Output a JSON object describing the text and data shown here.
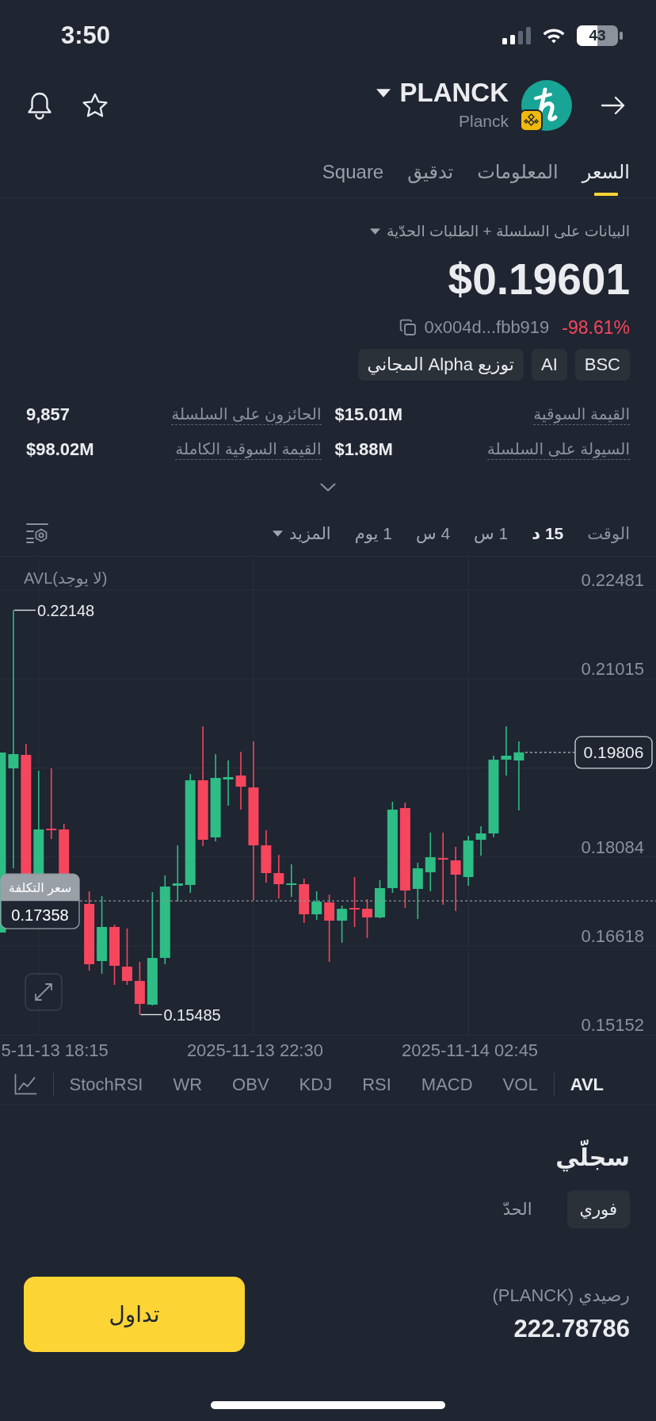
{
  "status_bar": {
    "time": "3:50",
    "battery": "43"
  },
  "header": {
    "symbol": "PLANCK",
    "name": "Planck"
  },
  "tabs": [
    {
      "label": "السعر",
      "selected": true
    },
    {
      "label": "المعلومات",
      "selected": false
    },
    {
      "label": "تدقيق",
      "selected": false
    },
    {
      "label": "Square",
      "selected": false
    }
  ],
  "price_section": {
    "source": "البيانات على السلسلة + الطلبات الحدّية",
    "price": "$0.19601",
    "contract": "0x004d...fbb919",
    "change": "-98.61%",
    "change_up": false,
    "tags": [
      "BSC",
      "AI",
      "توزيع Alpha المجاني"
    ]
  },
  "stats": [
    {
      "label": "القيمة السوقية",
      "value": "$15.01M"
    },
    {
      "label": "الحائزون على السلسلة",
      "value": "9,857"
    },
    {
      "label": "السيولة على السلسلة",
      "value": "$1.88M"
    },
    {
      "label": "القيمة السوقية الكاملة",
      "value": "$98.02M"
    }
  ],
  "intervals": {
    "label": "الوقت",
    "items": [
      {
        "label": "15 د",
        "selected": true
      },
      {
        "label": "1 س",
        "selected": false
      },
      {
        "label": "4 س",
        "selected": false
      },
      {
        "label": "1 يوم",
        "selected": false
      }
    ],
    "more": "المزيد"
  },
  "chart": {
    "indicator_label": "AVL(لا يوجد)",
    "chart_data": {
      "type": "candlestick",
      "grid": true,
      "categories": [
        null,
        null,
        null,
        "5-11-13 18:15",
        null,
        null,
        null,
        null,
        null,
        null,
        null,
        null,
        null,
        null,
        null,
        null,
        null,
        null,
        null,
        null,
        "2025-11-13 22:30",
        null,
        null,
        null,
        null,
        null,
        null,
        null,
        null,
        null,
        null,
        null,
        null,
        null,
        null,
        null,
        null,
        "2025-11-14 02:45",
        null,
        null,
        null,
        null
      ],
      "ohlc": [
        [
          0.16837,
          0.19803,
          0.16837,
          0.19803
        ],
        [
          0.19542,
          0.22148,
          0.17896,
          0.19777
        ],
        null,
        null,
        [
          0.18549,
          0.19542,
          0.18379,
          0.18523
        ],
        null,
        null,
        [
          0.17308,
          0.17517,
          0.1621,
          0.16315
        ],
        [
          0.16367,
          0.17438,
          0.16158,
          0.16929
        ],
        [
          0.16929,
          0.16968,
          0.15975,
          0.16289
        ],
        [
          0.16276,
          0.16903,
          0.15975,
          0.1604
        ],
        [
          0.1604,
          0.16354,
          0.15485,
          0.15662
        ],
        [
          0.15649,
          0.17504,
          0.15635,
          0.16419
        ],
        [
          0.16419,
          0.17778,
          0.16315,
          0.17595
        ],
        [
          0.17608,
          0.18274,
          0.17347,
          0.17647
        ],
        [
          0.17621,
          0.1945,
          0.17491,
          0.19346
        ],
        [
          0.19346,
          0.20234,
          0.18261,
          0.18366
        ],
        [
          0.18405,
          0.19777,
          0.1834,
          0.19385
        ],
        [
          0.19359,
          0.19672,
          0.18928,
          0.19398
        ],
        [
          0.19424,
          0.19816,
          0.18862,
          0.19241
        ],
        [
          0.19228,
          0.19986,
          0.17373,
          0.18274
        ],
        [
          0.18274,
          0.18523,
          0.1766,
          0.17817
        ],
        [
          0.17817,
          0.18118,
          0.17399,
          0.17634
        ],
        [
          0.17621,
          0.17961,
          0.17425,
          0.17647
        ],
        [
          0.17634,
          0.17726,
          0.16994,
          0.17138
        ],
        [
          0.17138,
          0.17517,
          0.17046,
          0.17347
        ],
        [
          0.17334,
          0.17464,
          0.16354,
          0.17033
        ],
        [
          0.17033,
          0.17282,
          0.16668,
          0.17229
        ],
        [
          0.17242,
          0.17752,
          0.16929,
          0.17216
        ],
        [
          0.17229,
          0.17386,
          0.16746,
          0.17086
        ],
        [
          0.17086,
          0.177,
          0.17073,
          0.17569
        ],
        [
          0.17569,
          0.18993,
          0.17491,
          0.18862
        ],
        [
          0.18888,
          0.1898,
          0.17242,
          0.1753
        ],
        [
          0.17556,
          0.17987,
          0.17059,
          0.17896
        ],
        [
          0.1783,
          0.18483,
          0.17517,
          0.18078
        ],
        [
          0.18065,
          0.18483,
          0.17295,
          0.18039
        ],
        [
          0.18026,
          0.18248,
          0.1719,
          0.17791
        ],
        [
          0.17752,
          0.18431,
          0.17608,
          0.18353
        ],
        [
          0.18366,
          0.18588,
          0.18105,
          0.1847
        ],
        [
          0.1847,
          0.19751,
          0.18405,
          0.19685
        ],
        [
          0.19685,
          0.20234,
          0.19424,
          0.19751
        ],
        [
          0.19672,
          0.19986,
          0.18849,
          0.19806
        ]
      ],
      "ylim": [
        0.15126,
        0.2303
      ],
      "yticks": [
        0.22481,
        0.21015,
        0.18084,
        0.16618,
        0.15152
      ],
      "ref_lines": [
        {
          "axis": "y",
          "value": 0.17358,
          "label": "0.17358"
        }
      ]
    },
    "high_label": "0.22148",
    "current_price": "0.19806",
    "cost_price_title": "سعر التكلفة",
    "low_label": "0.15485"
  },
  "main_indicators": [
    {
      "label": "AVL",
      "selected": true
    }
  ],
  "sub_indicators": [
    {
      "label": "VOL",
      "selected": false
    },
    {
      "label": "MACD",
      "selected": false
    },
    {
      "label": "RSI",
      "selected": false
    },
    {
      "label": "KDJ",
      "selected": false
    },
    {
      "label": "OBV",
      "selected": false
    },
    {
      "label": "WR",
      "selected": false
    },
    {
      "label": "StochRSI",
      "selected": false
    }
  ],
  "orders": {
    "title": "سجلّي",
    "tabs": [
      {
        "label": "فوري",
        "selected": true
      },
      {
        "label": "الحدّ",
        "selected": false
      }
    ]
  },
  "balance": {
    "label": "رصيدي (PLANCK)",
    "value": "222.78786"
  },
  "trade_button": "تداول"
}
